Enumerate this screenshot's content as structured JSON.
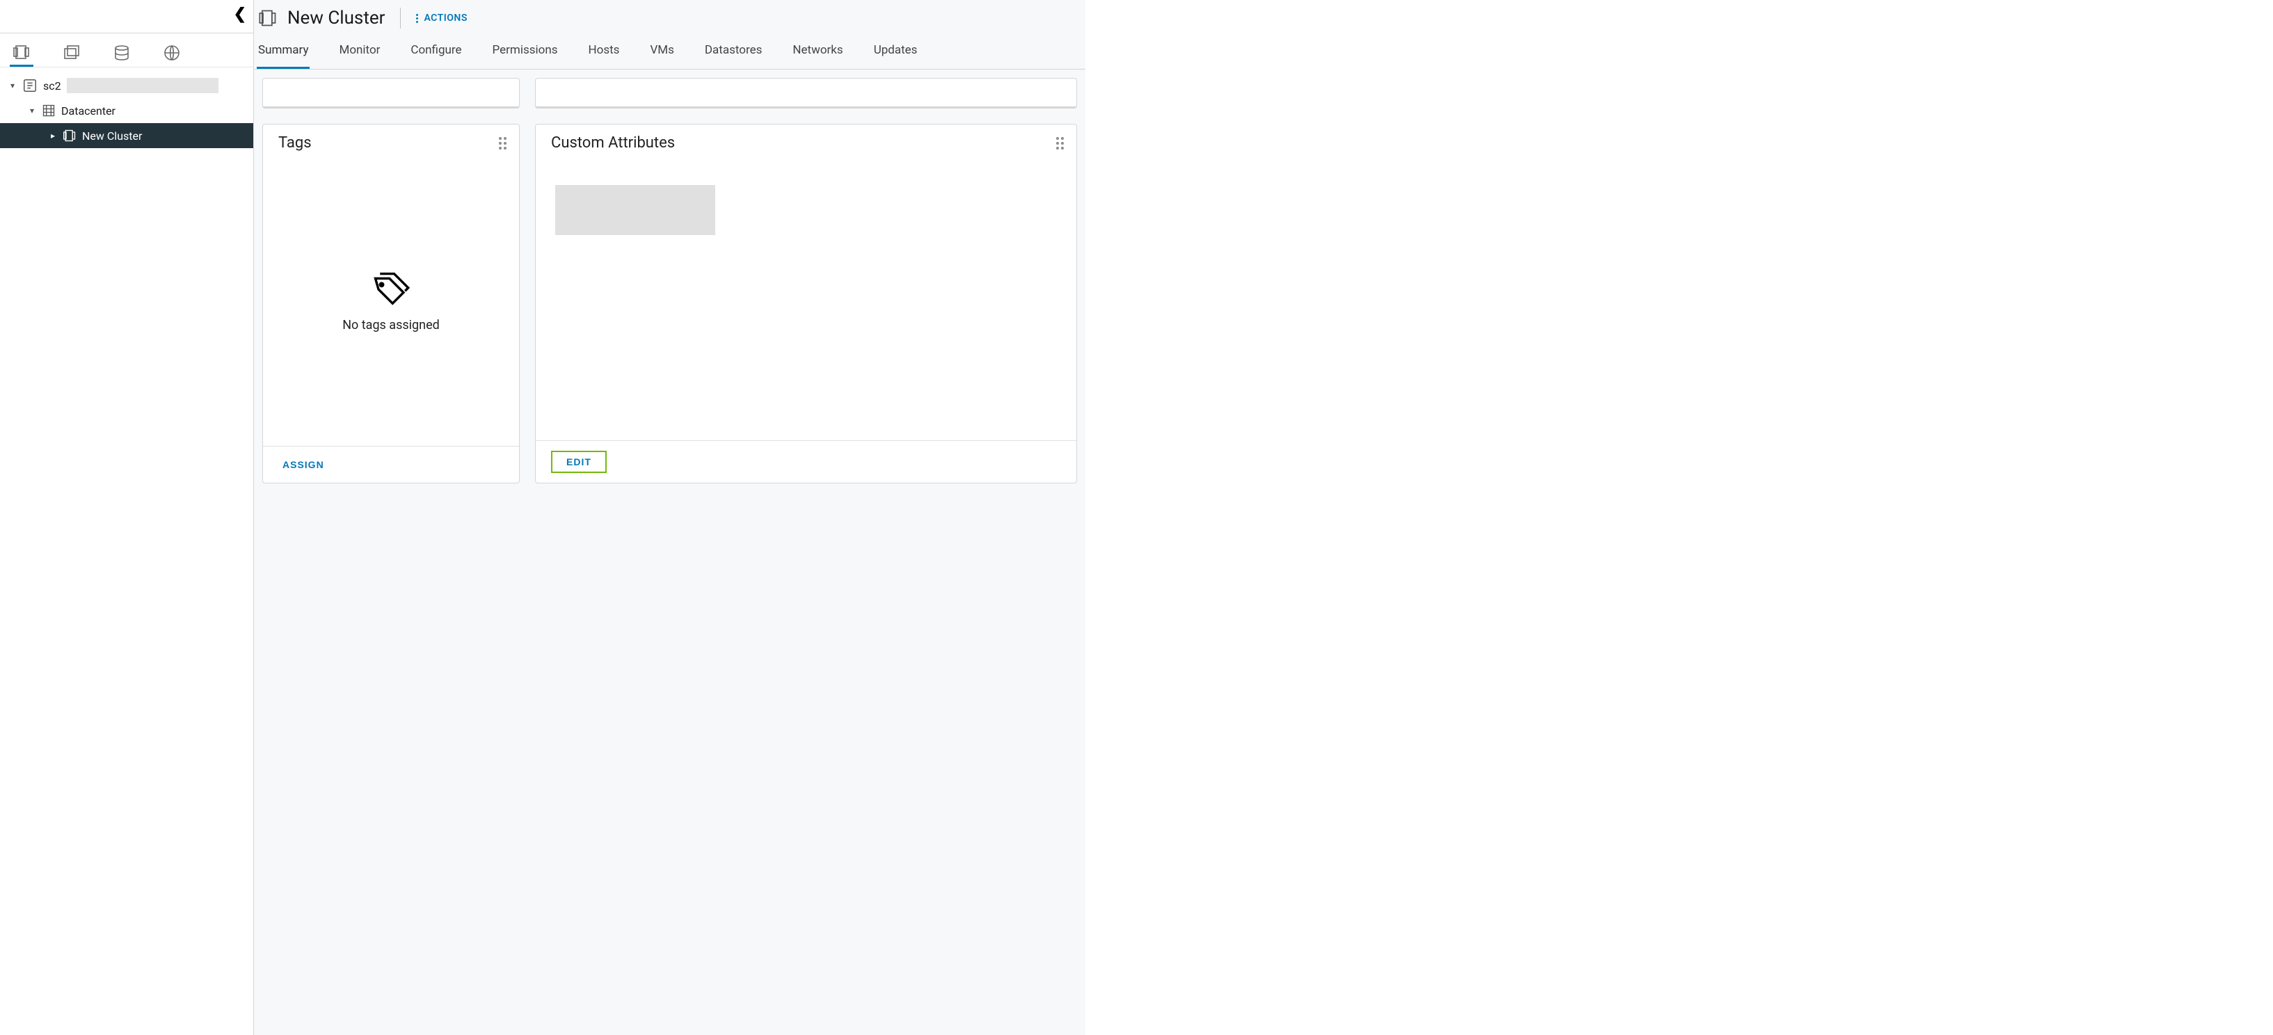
{
  "header": {
    "title": "New Cluster",
    "actions_label": "ACTIONS"
  },
  "tabs": {
    "items": [
      "Summary",
      "Monitor",
      "Configure",
      "Permissions",
      "Hosts",
      "VMs",
      "Datastores",
      "Networks",
      "Updates"
    ],
    "active": "Summary"
  },
  "tree": {
    "root_label": "sc2",
    "dc_label": "Datacenter",
    "cluster_label": "New Cluster"
  },
  "cards": {
    "tags": {
      "title": "Tags",
      "empty_text": "No tags assigned",
      "footer_btn": "ASSIGN"
    },
    "attrs": {
      "title": "Custom Attributes",
      "footer_btn": "EDIT"
    }
  }
}
